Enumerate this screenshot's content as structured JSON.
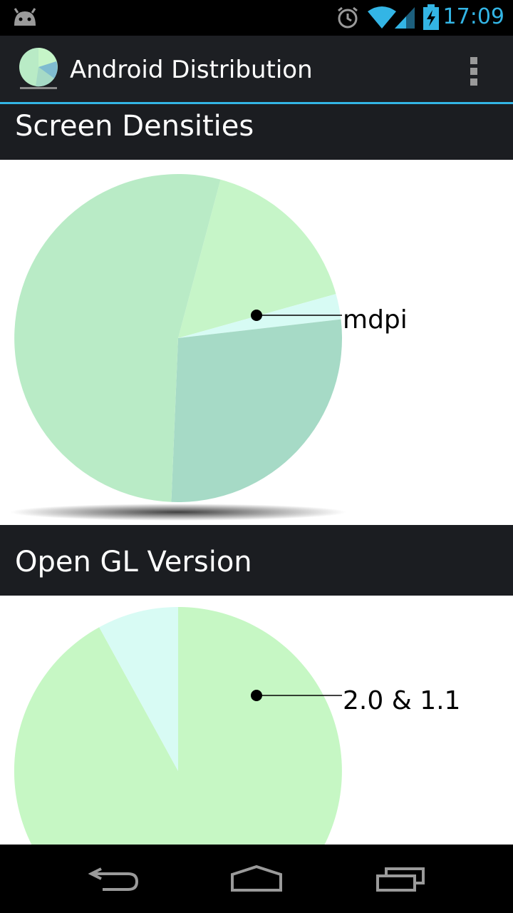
{
  "status_bar": {
    "time": "17:09",
    "icons": [
      "android-icon",
      "alarm-icon",
      "wifi-icon",
      "signal-icon",
      "battery-charging-icon"
    ],
    "accent_color": "#33b5e5"
  },
  "action_bar": {
    "title": "Android Distribution",
    "icons": [
      "app-pie-icon",
      "overflow-menu-icon"
    ]
  },
  "sections": [
    {
      "title": "Screen Densities",
      "label": "mdpi"
    },
    {
      "title": "Open GL Version",
      "label": "2.0 & 1.1"
    }
  ],
  "nav_bar": {
    "icons": [
      "back-icon",
      "home-icon",
      "recents-icon"
    ]
  },
  "chart_data": [
    {
      "type": "pie",
      "title": "Screen Densities",
      "labels": [
        "mdpi",
        "",
        "",
        ""
      ],
      "values": [
        16.5,
        2.5,
        27.5,
        53.5
      ],
      "colors": [
        "#c6f5c8",
        "#d7fbf4",
        "#a6dac6",
        "#b9ebc6"
      ],
      "highlighted": "mdpi"
    },
    {
      "type": "pie",
      "title": "Open GL Version",
      "labels": [
        "2.0 & 1.1",
        ""
      ],
      "values": [
        92,
        8
      ],
      "colors": [
        "#c6f7c4",
        "#d8fbf4"
      ],
      "highlighted": "2.0 & 1.1"
    }
  ]
}
